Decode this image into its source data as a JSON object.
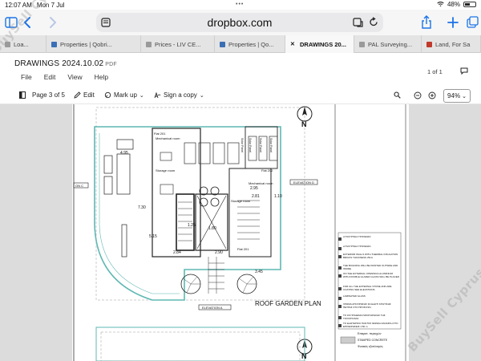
{
  "status_bar": {
    "time": "12:07 AM",
    "date": "Mon 7 Jul",
    "battery": "48%",
    "battery_level": 0.48,
    "dots": "•••"
  },
  "browser": {
    "url": "dropbox.com",
    "tabs": [
      {
        "label": "Loa...",
        "favicon": "grey",
        "active": false
      },
      {
        "label": "Properties | Qobri...",
        "favicon": "house",
        "active": false
      },
      {
        "label": "Prices - LIV CE...",
        "favicon": "grey",
        "active": false
      },
      {
        "label": "Properties | Qo...",
        "favicon": "house",
        "active": false
      },
      {
        "label": "DRAWINGS 20...",
        "favicon": "close",
        "active": true
      },
      {
        "label": "PAL Surveying...",
        "favicon": "grey",
        "active": false
      },
      {
        "label": "Land, For Sa",
        "favicon": "red",
        "active": false
      }
    ]
  },
  "document": {
    "title": "DRAWINGS 2024.10.02",
    "ext": "PDF",
    "menu": [
      "File",
      "Edit",
      "View",
      "Help"
    ],
    "page_count": "1 of 1"
  },
  "viewer_toolbar": {
    "page_label": "Page 3 of 5",
    "edit_label": "Edit",
    "markup_label": "Mark up",
    "sign_label": "Sign a copy",
    "zoom": "94%"
  },
  "drawing": {
    "plan_title": "ROOF GARDEN PLAN",
    "elevation_a": "ELEVATION A",
    "elevation_d": "ELEVATION D",
    "elevation_c": "ON C",
    "north": "N",
    "rooms": {
      "mechanical_room": "Mechanical room",
      "storage_room": "Storage room",
      "storage_room_2": "Storage room",
      "mechanical_room_2": "Mechanical room"
    },
    "flats": [
      "Flat 201",
      "Flat 201",
      "Flat 202"
    ],
    "solar_panels": [
      "Solar Panel",
      "Solar Panel",
      "Solar Panel",
      "Solar Panel"
    ],
    "dimensions": [
      "4.95",
      "7.30",
      "5.15",
      "1.25",
      "1.80",
      "2.90",
      "2.84",
      "3.45",
      "2.81",
      "1.10",
      "2.95"
    ],
    "legend_lines": [
      "ΞΥΛΟΥΡΓΕΙΑ ΤΡΟΧΕΙΩΝ",
      "ΞΥΛΟΥΡΓΕΙΑ ΤΡΟΧΕΙΩΝ",
      "EXTERIOR WALLS WITH THERMAL INSULATION BRICKS THICKNESS 25cm",
      "THE BUILDING WILL BE PAINTED OUTSIDE AND INSIDE",
      "ON THE EXTERNAL OPENINGS ALUMINIUM WITH DOUBLE GLAZED GLASS WILL BE PLACED",
      "FOR ALL THE EXTERNAL STONE AND ARE COATING SEE ELEVATIONS",
      "LAMINATED GLASS",
      "ΧΡΩΜΑ ΑΠΟΧΡΩΣΗΣ ΣΑ ΕΞΩΤΙ ΚΡΗΤΙΚΗΣ ΠΕΤΡΑΣ ΣΤΟ ΠΡΟΣΟΨΗ",
      "ΤΟ ΣΚΥΡΟΔΕΜΑ ΠΑΡΑΤΗΡΗΣΗΣ ΤΗΣ ΤΟΙΧΟΠΟΙΙΑΣ",
      "TO ΕΞΩΤΕΡΙΚΟ ΠΑΝΤΟΣ ΦΑΡΔΙΑ ΖΑΝΑΣΚΗ ΣΤΟ ΕΠΙΧΕΙΡΗΣΕΙΣ 1:50 m"
    ],
    "legend_items": [
      "Επικρατ. περιοχών",
      "STAMPED CONCRETE",
      "Φυσικός εξοπλισμός"
    ]
  },
  "watermark": {
    "text": "BuySell Cyprus"
  },
  "colors": {
    "accent": "#1a73e8",
    "plan_green": "#5fb8b3",
    "tab_bar": "#e4e4e4",
    "urlbar": "#e9e9eb"
  },
  "icons": [
    "wifi-icon",
    "battery-icon",
    "sidebar-icon",
    "back-icon",
    "forward-icon",
    "reader-icon",
    "translate-icon",
    "reload-icon",
    "share-icon",
    "add-tab-icon",
    "tabs-overview-icon",
    "comment-icon",
    "sidebar-toggle-icon",
    "pencil-icon",
    "markup-icon",
    "sign-icon",
    "search-icon",
    "zoom-out-icon",
    "zoom-in-icon"
  ]
}
